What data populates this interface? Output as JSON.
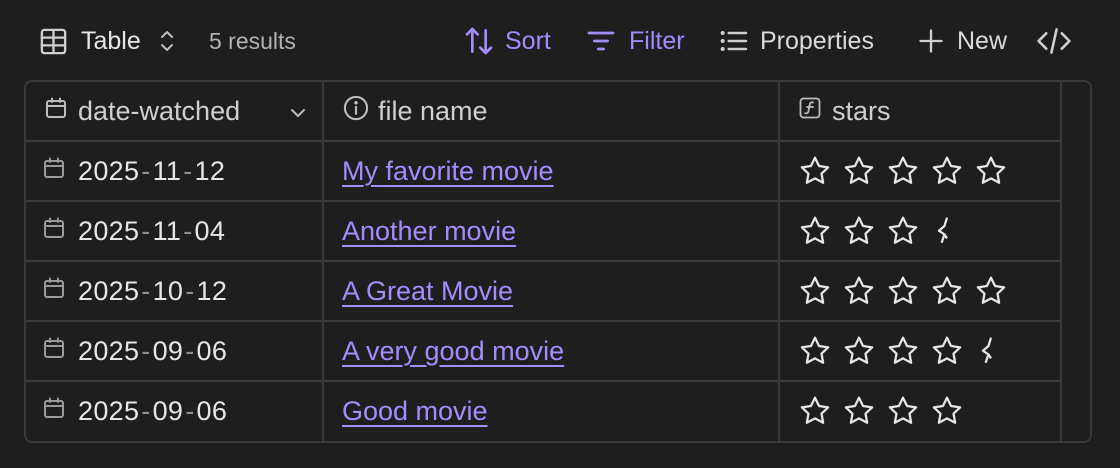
{
  "toolbar": {
    "view_icon": "table-icon",
    "view_label": "Table",
    "view_chevron_icon": "chevron-up-down-icon",
    "result_count": "5 results",
    "sort_icon": "sort-arrows-icon",
    "sort_label": "Sort",
    "filter_icon": "filter-icon",
    "filter_label": "Filter",
    "properties_icon": "list-icon",
    "properties_label": "Properties",
    "new_icon": "plus-icon",
    "new_label": "New",
    "code_icon": "code-icon"
  },
  "colors": {
    "background": "#1e1e1e",
    "accent": "#a48cff",
    "border": "#3a3a3a",
    "text": "#dadada"
  },
  "table": {
    "columns": [
      {
        "icon": "calendar-icon",
        "label": "date-watched",
        "menu_icon": "chevron-down-icon"
      },
      {
        "icon": "info-icon",
        "label": "file name"
      },
      {
        "icon": "formula-icon",
        "label": "stars"
      }
    ],
    "rows": [
      {
        "date": {
          "y": "2025",
          "m": "11",
          "d": "12"
        },
        "file": "My favorite movie",
        "stars": 5
      },
      {
        "date": {
          "y": "2025",
          "m": "11",
          "d": "04"
        },
        "file": "Another movie",
        "stars": 3.5
      },
      {
        "date": {
          "y": "2025",
          "m": "10",
          "d": "12"
        },
        "file": "A Great Movie",
        "stars": 5
      },
      {
        "date": {
          "y": "2025",
          "m": "09",
          "d": "06"
        },
        "file": "A very good movie",
        "stars": 4.5
      },
      {
        "date": {
          "y": "2025",
          "m": "09",
          "d": "06"
        },
        "file": "Good movie",
        "stars": 4
      }
    ]
  }
}
